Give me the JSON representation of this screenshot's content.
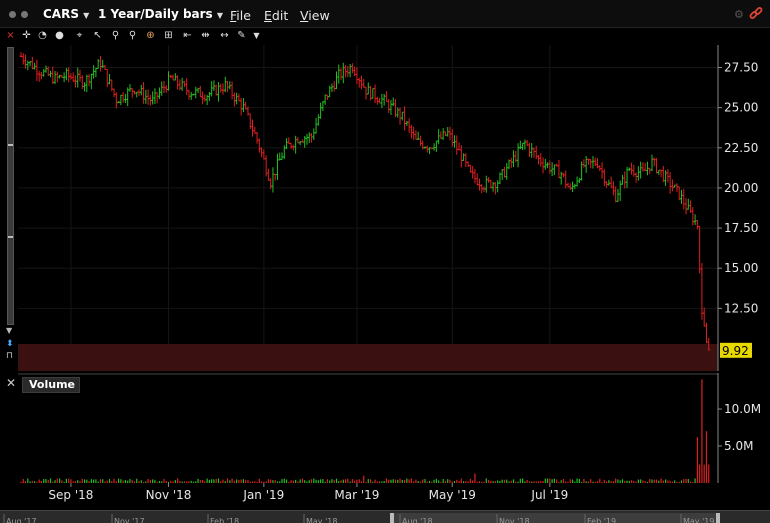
{
  "header": {
    "symbol": "CARS",
    "period": "1 Year/Daily bars",
    "menus": [
      {
        "label": "File",
        "key": "F",
        "rest": "ile"
      },
      {
        "label": "Edit",
        "key": "E",
        "rest": "dit"
      },
      {
        "label": "View",
        "key": "V",
        "rest": "iew"
      }
    ]
  },
  "toolbar": {
    "icons": [
      "close-x-icon",
      "crosshair-icon",
      "gauge-icon",
      "circle-icon",
      "pointer-icon",
      "zoom-in-icon",
      "zoom-out-icon",
      "target-icon",
      "fit-icon",
      "bar-width-icon",
      "compress-icon",
      "expand-icon",
      "wrench-icon",
      "dropdown-icon"
    ]
  },
  "chart_data": {
    "type": "ohlc",
    "price_axis": {
      "ticks": [
        "27.50",
        "25.00",
        "22.50",
        "20.00",
        "17.50",
        "15.00",
        "12.50"
      ],
      "tick_values": [
        27.5,
        25.0,
        22.5,
        20.0,
        17.5,
        15.0,
        12.5
      ],
      "range": [
        8.6,
        28.9
      ]
    },
    "last_price": {
      "label": "9.92",
      "value": 9.92
    },
    "x_axis": {
      "labels": [
        "Sep '18",
        "Nov '18",
        "Jan '19",
        "Mar '19",
        "May '19",
        "Jul '19"
      ],
      "label_day_index": [
        22,
        65,
        107,
        148,
        190,
        233
      ]
    },
    "volume_axis": {
      "ticks": [
        "10.0M",
        "5.0M"
      ],
      "tick_values": [
        10.0,
        5.0
      ],
      "range": [
        0,
        14.6
      ]
    },
    "volume_title": "Volume",
    "overview_labels": [
      "Aug '17",
      "Nov '17",
      "Feb '18",
      "May '18",
      "Aug '18",
      "Nov '18",
      "Feb '19",
      "May '19"
    ],
    "price_path": [
      [
        0,
        28.2
      ],
      [
        8,
        27.3
      ],
      [
        15,
        26.8
      ],
      [
        20,
        27.0
      ],
      [
        28,
        26.6
      ],
      [
        35,
        27.8
      ],
      [
        42,
        25.5
      ],
      [
        50,
        26.2
      ],
      [
        58,
        25.4
      ],
      [
        66,
        26.8
      ],
      [
        74,
        26.0
      ],
      [
        82,
        25.8
      ],
      [
        90,
        26.4
      ],
      [
        98,
        25.0
      ],
      [
        104,
        23.0
      ],
      [
        110,
        20.4
      ],
      [
        116,
        22.4
      ],
      [
        122,
        23.1
      ],
      [
        128,
        23.2
      ],
      [
        134,
        25.6
      ],
      [
        140,
        27.0
      ],
      [
        146,
        27.6
      ],
      [
        152,
        26.1
      ],
      [
        160,
        25.4
      ],
      [
        168,
        24.4
      ],
      [
        174,
        22.9
      ],
      [
        180,
        22.6
      ],
      [
        188,
        23.4
      ],
      [
        194,
        22.0
      ],
      [
        198,
        20.8
      ],
      [
        204,
        20.2
      ],
      [
        210,
        20.4
      ],
      [
        216,
        21.6
      ],
      [
        222,
        22.8
      ],
      [
        228,
        21.8
      ],
      [
        234,
        21.2
      ],
      [
        238,
        20.9
      ],
      [
        242,
        19.8
      ],
      [
        248,
        21.4
      ],
      [
        254,
        21.6
      ],
      [
        258,
        20.4
      ],
      [
        262,
        19.5
      ],
      [
        268,
        21.2
      ],
      [
        274,
        20.9
      ],
      [
        278,
        21.6
      ],
      [
        284,
        20.6
      ],
      [
        290,
        19.6
      ],
      [
        294,
        18.6
      ],
      [
        298,
        17.7
      ],
      [
        300,
        12.2
      ],
      [
        301,
        11.4
      ],
      [
        302,
        10.4
      ],
      [
        303,
        9.92
      ]
    ],
    "volume_profile": {
      "baseline_m": 0.35,
      "spikes": [
        [
          151,
          1.0
        ],
        [
          200,
          1.3
        ],
        [
          298,
          6.2
        ],
        [
          300,
          14.0
        ],
        [
          302,
          7.0
        ]
      ]
    }
  }
}
